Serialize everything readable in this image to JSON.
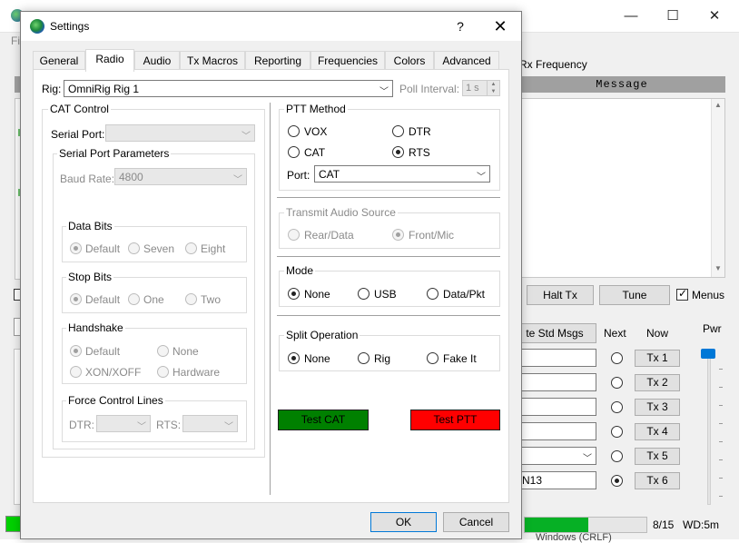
{
  "main": {
    "menu_partial": "Fil",
    "rx_frequency_label": "Rx Frequency",
    "message_header": "Message",
    "halt_tx": "Halt Tx",
    "tune": "Tune",
    "menus_label": "Menus",
    "pwr_label": "Pwr",
    "std_msgs": "te Std Msgs",
    "next_label": "Next",
    "now_label": "Now",
    "tx_buttons": [
      "Tx 1",
      "Tx 2",
      "Tx 3",
      "Tx 4",
      "Tx 5",
      "Tx 6"
    ],
    "tx6_text": "N13",
    "progress_text": "8/15",
    "progress_fraction": 0.52,
    "wd_label": "WD:5m",
    "windows_text": "Windows (CRLF)",
    "window_controls": {
      "minimize": "—",
      "maximize": "☐",
      "close": "✕"
    }
  },
  "dialog": {
    "title": "Settings",
    "help": "?",
    "close": "✕",
    "tabs": [
      "General",
      "Radio",
      "Audio",
      "Tx Macros",
      "Reporting",
      "Frequencies",
      "Colors",
      "Advanced"
    ],
    "active_tab": "Radio",
    "rig_label": "Rig:",
    "rig_value": "OmniRig Rig 1",
    "poll_interval_label": "Poll Interval:",
    "poll_interval_value": "1 s",
    "cat_control": {
      "title": "CAT Control",
      "serial_port_label": "Serial Port:",
      "serial_port_value": "",
      "params_title": "Serial Port Parameters",
      "baud_rate_label": "Baud Rate:",
      "baud_rate_value": "4800",
      "data_bits": {
        "title": "Data Bits",
        "options": [
          "Default",
          "Seven",
          "Eight"
        ],
        "selected": "Default"
      },
      "stop_bits": {
        "title": "Stop Bits",
        "options": [
          "Default",
          "One",
          "Two"
        ],
        "selected": "Default"
      },
      "handshake": {
        "title": "Handshake",
        "options": [
          "Default",
          "None",
          "XON/XOFF",
          "Hardware"
        ],
        "selected": "Default"
      },
      "force_control": {
        "title": "Force Control Lines",
        "dtr_label": "DTR:",
        "rts_label": "RTS:"
      }
    },
    "ptt_method": {
      "title": "PTT Method",
      "options": [
        "VOX",
        "DTR",
        "CAT",
        "RTS"
      ],
      "selected": "RTS",
      "port_label": "Port:",
      "port_value": "CAT"
    },
    "transmit_audio": {
      "title": "Transmit Audio Source",
      "options": [
        "Rear/Data",
        "Front/Mic"
      ],
      "selected": "Front/Mic"
    },
    "mode": {
      "title": "Mode",
      "options": [
        "None",
        "USB",
        "Data/Pkt"
      ],
      "selected": "None"
    },
    "split": {
      "title": "Split Operation",
      "options": [
        "None",
        "Rig",
        "Fake It"
      ],
      "selected": "None"
    },
    "test_cat": "Test CAT",
    "test_ptt": "Test PTT",
    "ok": "OK",
    "cancel": "Cancel",
    "colors": {
      "test_cat": "#008000",
      "test_ptt": "#ff0000",
      "accent": "#0078d7"
    }
  }
}
